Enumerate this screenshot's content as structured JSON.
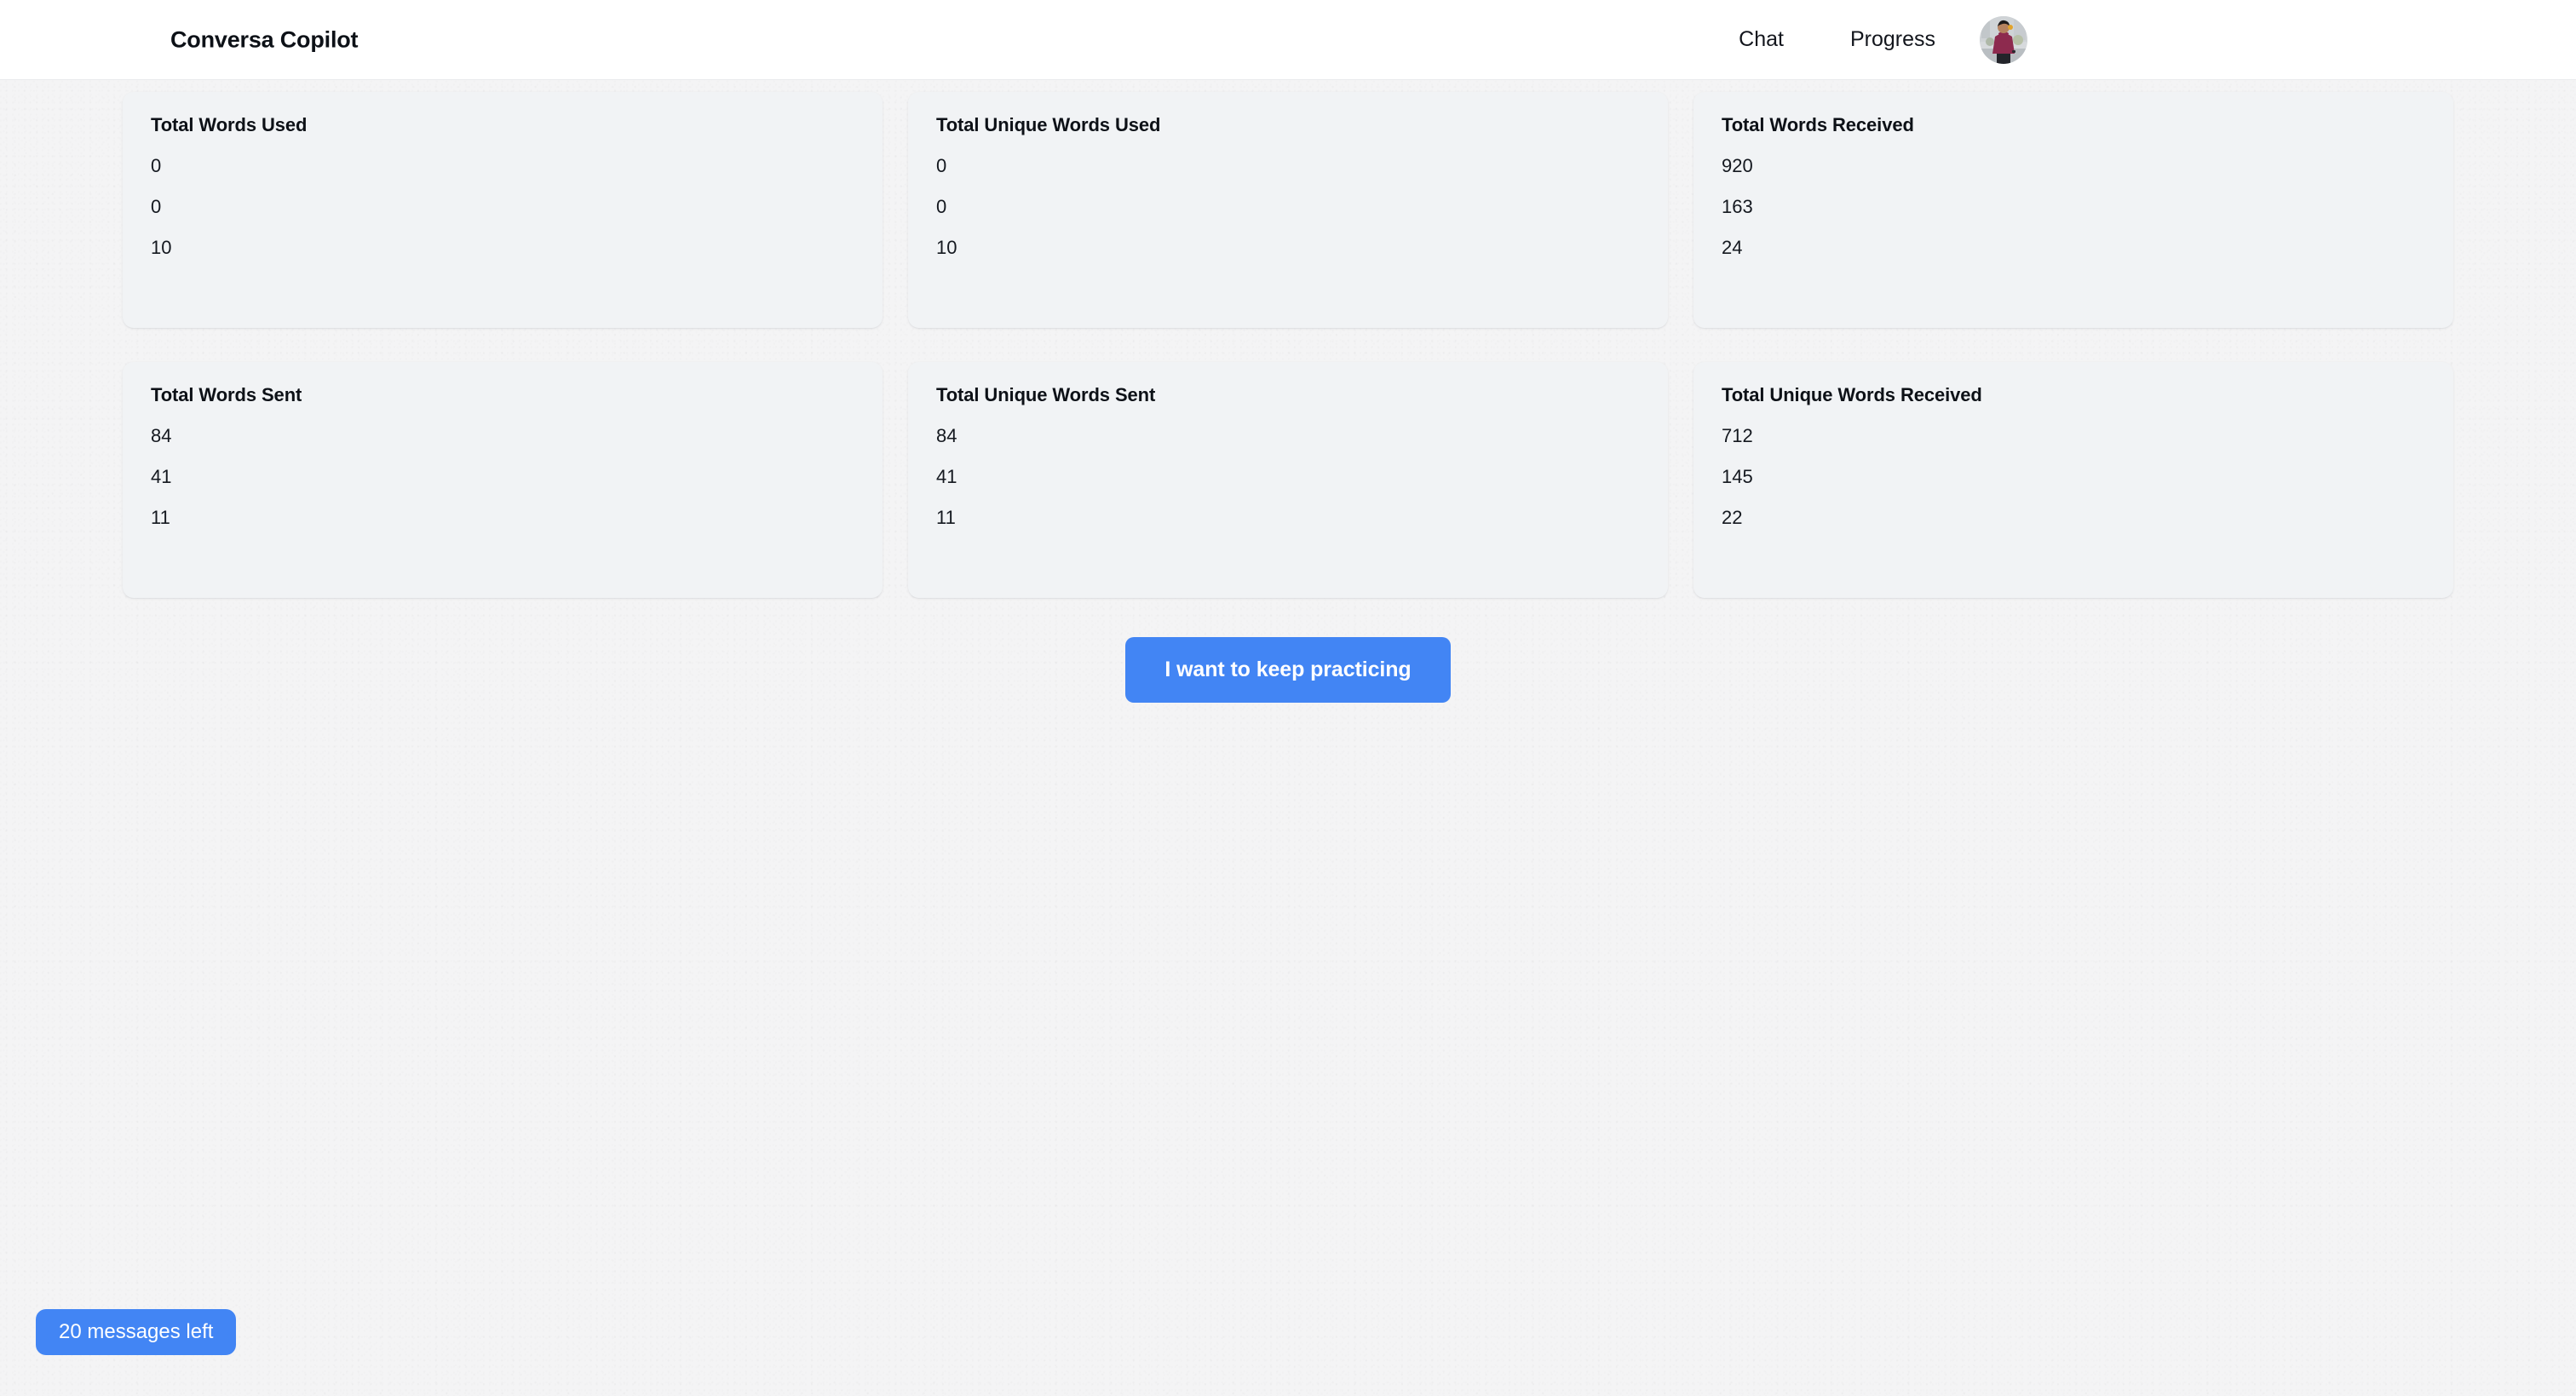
{
  "header": {
    "brand": "Conversa Copilot",
    "nav": [
      {
        "label": "Chat",
        "name": "nav-link-chat"
      },
      {
        "label": "Progress",
        "name": "nav-link-progress"
      }
    ],
    "avatar_alt": "user-avatar"
  },
  "stats": [
    {
      "title": "Total Words Used",
      "values": [
        "0",
        "0",
        "10"
      ]
    },
    {
      "title": "Total Unique Words Used",
      "values": [
        "0",
        "0",
        "10"
      ]
    },
    {
      "title": "Total Words Received",
      "values": [
        "920",
        "163",
        "24"
      ]
    },
    {
      "title": "Total Words Sent",
      "values": [
        "84",
        "41",
        "11"
      ]
    },
    {
      "title": "Total Unique Words Sent",
      "values": [
        "84",
        "41",
        "11"
      ]
    },
    {
      "title": "Total Unique Words Received",
      "values": [
        "712",
        "145",
        "22"
      ]
    }
  ],
  "cta": {
    "label": "I want to keep practicing"
  },
  "badge": {
    "label": "20 messages left"
  },
  "colors": {
    "accent": "#4285f4",
    "page_background": "#f4f4f5",
    "card_background": "#f1f3f5",
    "header_background": "#ffffff",
    "text_primary": "#0d1117"
  }
}
